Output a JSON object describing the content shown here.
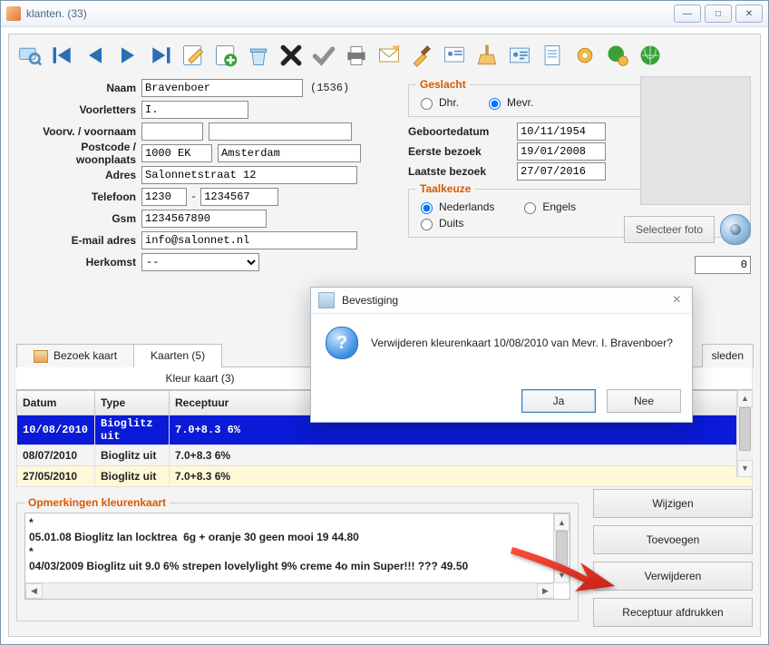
{
  "window": {
    "title": "klanten.  (33)"
  },
  "toolbar_icons": [
    "search",
    "first",
    "prev",
    "next",
    "last",
    "edit",
    "add",
    "recycle",
    "delete",
    "ok",
    "print",
    "mail",
    "brush",
    "card",
    "sweep",
    "id",
    "doc",
    "gear",
    "globe-gear",
    "globe"
  ],
  "labels": {
    "naam": "Naam",
    "voorletters": "Voorletters",
    "voorv": "Voorv. / voornaam",
    "postcode": "Postcode / woonplaats",
    "adres": "Adres",
    "telefoon": "Telefoon",
    "gsm": "Gsm",
    "email": "E-mail adres",
    "herkomst": "Herkomst",
    "geslacht": "Geslacht",
    "dhr": "Dhr.",
    "mevr": "Mevr.",
    "geboorte": "Geboortedatum",
    "eerste": "Eerste bezoek",
    "laatste": "Laatste bezoek",
    "taal": "Taalkeuze",
    "nl": "Nederlands",
    "en": "Engels",
    "de": "Duits",
    "selecteer_foto": "Selecteer foto",
    "kortnr": "0"
  },
  "customer": {
    "naam": "Bravenboer",
    "id": "(1536)",
    "voorletters": "I.",
    "voorv": "",
    "postcode": "1000 EK",
    "plaats": "Amsterdam",
    "adres": "Salonnetstraat 12",
    "tel_area": "1230",
    "tel_num": "1234567",
    "gsm": "1234567890",
    "email": "info@salonnet.nl",
    "herkomst": "--",
    "geboorte": "10/11/1954",
    "eerste": "19/01/2008",
    "laatste": "27/07/2016",
    "geslacht": "Mevr.",
    "taal": "Nederlands"
  },
  "tabs": {
    "main": [
      "Bezoek kaart",
      "Kaarten (5)"
    ],
    "overflow": "sleden",
    "sub": [
      "Kleur kaart (3)"
    ]
  },
  "grid": {
    "headers": [
      "Datum",
      "Type",
      "Receptuur"
    ],
    "rows": [
      {
        "datum": "10/08/2010",
        "type": "Bioglitz uit",
        "receptuur": "7.0+8.3 6%",
        "sel": true
      },
      {
        "datum": "08/07/2010",
        "type": "Bioglitz uit",
        "receptuur": "7.0+8.3 6%",
        "sel": false
      },
      {
        "datum": "27/05/2010",
        "type": "Bioglitz uit",
        "receptuur": "7.0+8.3 6%",
        "sel": false
      }
    ]
  },
  "remarks": {
    "legend": "Opmerkingen kleurenkaart",
    "text": "*\n05.01.08 Bioglitz lan locktrea  6g + oranje 30 geen mooi 19 44.80\n*\n04/03/2009 Bioglitz uit 9.0 6% strepen lovelylight 9% creme 4o min Super!!! ??? 49.50"
  },
  "buttons": {
    "wijzigen": "Wijzigen",
    "toevoegen": "Toevoegen",
    "verwijderen": "Verwijderen",
    "receptuur": "Receptuur afdrukken"
  },
  "dialog": {
    "title": "Bevestiging",
    "msg": "Verwijderen kleurenkaart 10/08/2010 van Mevr. I. Bravenboer?",
    "ja": "Ja",
    "nee": "Nee"
  }
}
